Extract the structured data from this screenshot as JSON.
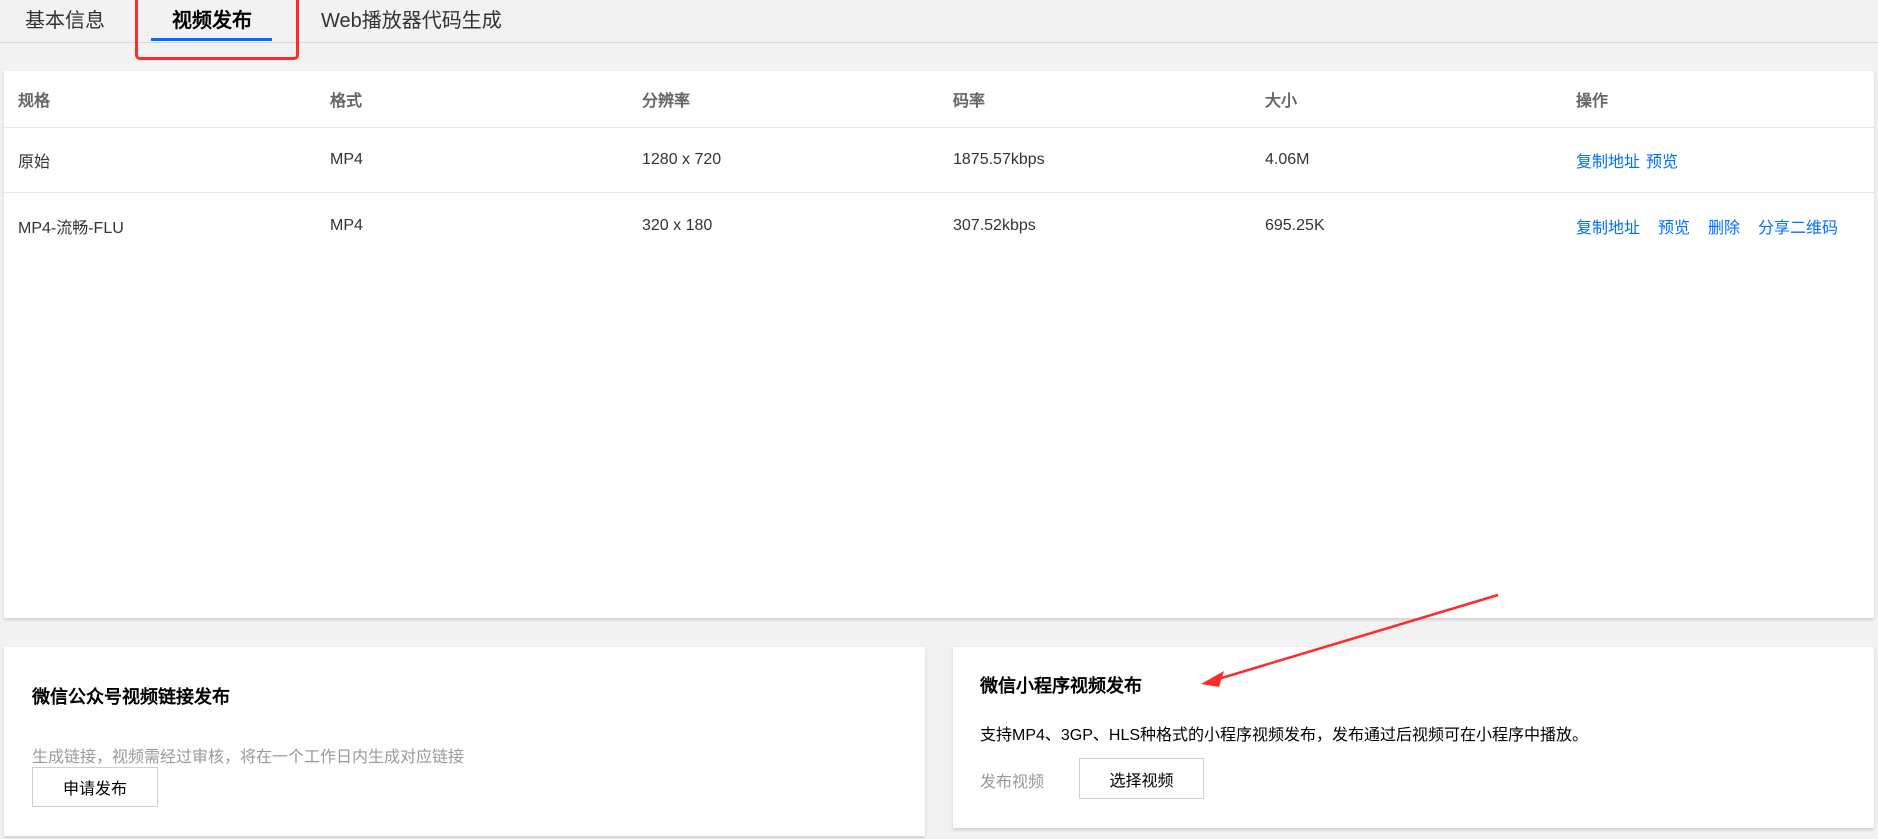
{
  "tabs": [
    {
      "label": "基本信息"
    },
    {
      "label": "视频发布"
    },
    {
      "label": "Web播放器代码生成"
    }
  ],
  "table": {
    "headers": [
      "规格",
      "格式",
      "分辨率",
      "码率",
      "大小",
      "操作"
    ],
    "rows": [
      {
        "spec": "原始",
        "format": "MP4",
        "resolution": "1280 x 720",
        "bitrate": "1875.57kbps",
        "size": "4.06M",
        "actions": [
          "复制地址",
          "预览"
        ]
      },
      {
        "spec": "MP4-流畅-FLU",
        "format": "MP4",
        "resolution": "320 x 180",
        "bitrate": "307.52kbps",
        "size": "695.25K",
        "actions": [
          "复制地址",
          "预览",
          "删除",
          "分享二维码"
        ]
      }
    ]
  },
  "wechat_official": {
    "title": "微信公众号视频链接发布",
    "desc": "生成链接，视频需经过审核，将在一个工作日内生成对应链接",
    "button": "申请发布"
  },
  "wechat_miniprogram": {
    "title": "微信小程序视频发布",
    "desc": "支持MP4、3GP、HLS种格式的小程序视频发布，发布通过后视频可在小程序中播放。",
    "field_label": "发布视频",
    "button": "选择视频"
  },
  "colors": {
    "accent": "#006eff",
    "annotation": "#ff2a2a",
    "background": "#f2f2f2"
  }
}
